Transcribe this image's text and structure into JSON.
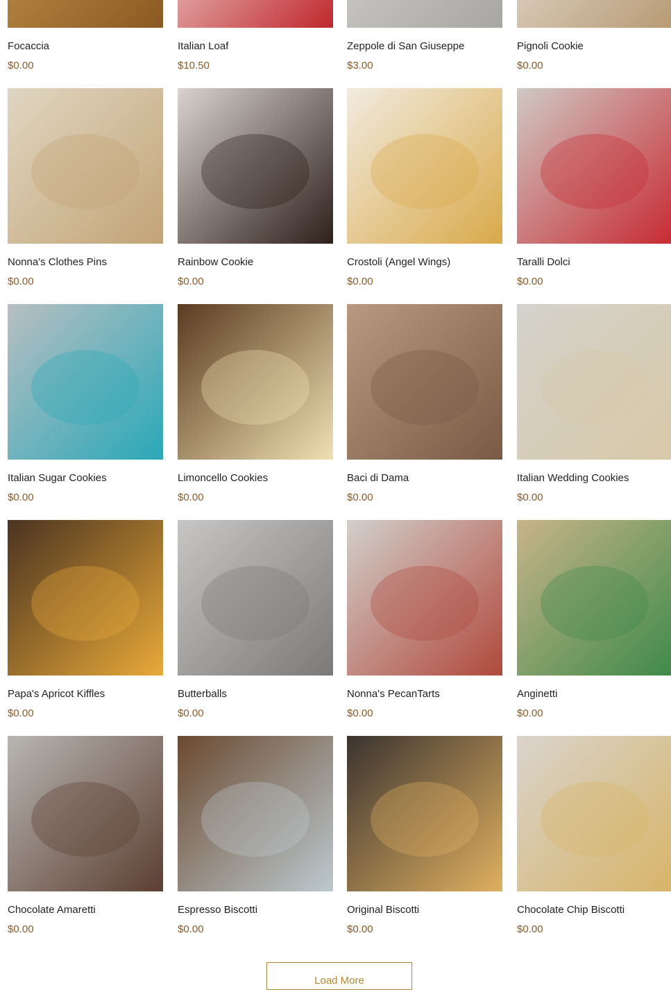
{
  "colors": {
    "accent": "#b08a2e",
    "price": "#8a5a2b",
    "text": "#222222"
  },
  "load_more": {
    "label": "Load More"
  },
  "products": [
    {
      "name": "Focaccia",
      "price": "$0.00",
      "image": "focaccia-photo",
      "swatch": [
        "#c99a4e",
        "#8a5a23"
      ]
    },
    {
      "name": "Italian Loaf",
      "price": "$10.50",
      "image": "bread-bag-photo",
      "swatch": [
        "#f4ece8",
        "#c0282d"
      ]
    },
    {
      "name": "Zeppole di San Giuseppe",
      "price": "$3.00",
      "image": "zeppole-photo",
      "swatch": [
        "#d8d6d2",
        "#a8a6a2"
      ]
    },
    {
      "name": "Pignoli Cookie",
      "price": "$0.00",
      "image": "pignoli-photo",
      "swatch": [
        "#ece8e2",
        "#b79a74"
      ]
    },
    {
      "name": "Nonna's Clothes Pins",
      "price": "$0.00",
      "image": "clothes-pins-photo",
      "swatch": [
        "#e0d6c2",
        "#c2a476"
      ]
    },
    {
      "name": "Rainbow Cookie",
      "price": "$0.00",
      "image": "rainbow-cookie-photo",
      "swatch": [
        "#d9d3cf",
        "#2e1f1a"
      ]
    },
    {
      "name": "Crostoli (Angel Wings)",
      "price": "$0.00",
      "image": "crostoli-photo",
      "swatch": [
        "#f1ebe0",
        "#d9a94a"
      ]
    },
    {
      "name": "Taralli Dolci",
      "price": "$0.00",
      "image": "taralli-photo",
      "swatch": [
        "#cfc9c4",
        "#c72b33"
      ]
    },
    {
      "name": "Italian Sugar Cookies",
      "price": "$0.00",
      "image": "sugar-cookies-photo",
      "swatch": [
        "#b8bfc2",
        "#2aa8b8"
      ]
    },
    {
      "name": "Limoncello Cookies",
      "price": "$0.00",
      "image": "limoncello-photo",
      "swatch": [
        "#5a3b20",
        "#efe0b2"
      ]
    },
    {
      "name": "Baci di Dama",
      "price": "$0.00",
      "image": "baci-di-dama-photo",
      "swatch": [
        "#b89a80",
        "#7a5a45"
      ]
    },
    {
      "name": "Italian Wedding Cookies",
      "price": "$0.00",
      "image": "wedding-cookies-photo",
      "swatch": [
        "#d4d2cc",
        "#d8c9a8"
      ]
    },
    {
      "name": "Papa's Apricot Kiffles",
      "price": "$0.00",
      "image": "kiffles-photo",
      "swatch": [
        "#4a3320",
        "#e8a938"
      ]
    },
    {
      "name": "Butterballs",
      "price": "$0.00",
      "image": "butterballs-photo",
      "swatch": [
        "#c8c6c4",
        "#7c7a78"
      ]
    },
    {
      "name": "Nonna's PecanTarts",
      "price": "$0.00",
      "image": "pecan-tarts-photo",
      "swatch": [
        "#d2cfcb",
        "#b0493c"
      ]
    },
    {
      "name": "Anginetti",
      "price": "$0.00",
      "image": "anginetti-photo",
      "swatch": [
        "#c8b48a",
        "#3f8a4a"
      ]
    },
    {
      "name": "Chocolate Amaretti",
      "price": "$0.00",
      "image": "amaretti-photo",
      "swatch": [
        "#b8b6b2",
        "#5c3f32"
      ]
    },
    {
      "name": "Espresso Biscotti",
      "price": "$0.00",
      "image": "espresso-biscotti-photo",
      "swatch": [
        "#6b4a30",
        "#bcc9cf"
      ]
    },
    {
      "name": "Original Biscotti",
      "price": "$0.00",
      "image": "original-biscotti-photo",
      "swatch": [
        "#3b3430",
        "#e0b060"
      ]
    },
    {
      "name": "Chocolate Chip Biscotti",
      "price": "$0.00",
      "image": "chocolate-chip-biscotti-photo",
      "swatch": [
        "#d9d4cc",
        "#d8b468"
      ]
    }
  ]
}
